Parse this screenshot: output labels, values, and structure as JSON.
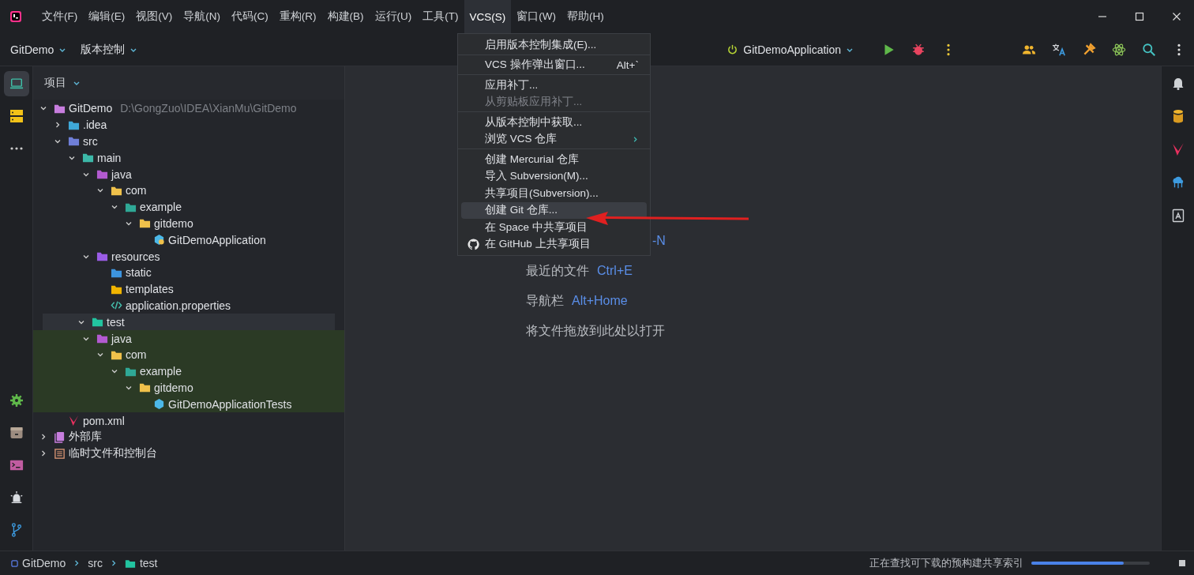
{
  "menu_bar": [
    {
      "label": "文件(F)",
      "selected": false
    },
    {
      "label": "编辑(E)",
      "selected": false
    },
    {
      "label": "视图(V)",
      "selected": false
    },
    {
      "label": "导航(N)",
      "selected": false
    },
    {
      "label": "代码(C)",
      "selected": false
    },
    {
      "label": "重构(R)",
      "selected": false
    },
    {
      "label": "构建(B)",
      "selected": false
    },
    {
      "label": "运行(U)",
      "selected": false
    },
    {
      "label": "工具(T)",
      "selected": false
    },
    {
      "label": "VCS(S)",
      "selected": true
    },
    {
      "label": "窗口(W)",
      "selected": false
    },
    {
      "label": "帮助(H)",
      "selected": false
    }
  ],
  "toolbar": {
    "project": "GitDemo",
    "vcs": "版本控制",
    "run_config": "GitDemoApplication"
  },
  "left_stripe": {
    "top": [
      {
        "selected": true
      },
      {
        "selected": false
      },
      {
        "selected": false
      }
    ],
    "bottom": [
      {
        "selected": false
      },
      {
        "selected": false
      },
      {
        "selected": false
      },
      {
        "selected": false
      },
      {
        "selected": false
      }
    ]
  },
  "project_panel": {
    "title": "项目"
  },
  "project_tree": [
    {
      "label": "GitDemo",
      "path": "D:\\GongZuo\\IDEA\\XianMu\\GitDemo",
      "kind": "module",
      "expanded": true,
      "selected": false,
      "highlighted": false,
      "children": [
        {
          "label": ".idea",
          "kind": "config",
          "expanded": false,
          "selected": false,
          "highlighted": false
        },
        {
          "label": "src",
          "kind": "src",
          "expanded": true,
          "selected": false,
          "highlighted": false,
          "children": [
            {
              "label": "main",
              "kind": "teal-folder",
              "expanded": true,
              "selected": false,
              "highlighted": false,
              "children": [
                {
                  "label": "java",
                  "kind": "java-root",
                  "expanded": true,
                  "selected": false,
                  "highlighted": false,
                  "children": [
                    {
                      "label": "com",
                      "kind": "package",
                      "expanded": true,
                      "selected": false,
                      "highlighted": false,
                      "children": [
                        {
                          "label": "example",
                          "kind": "teal-package",
                          "expanded": true,
                          "selected": false,
                          "highlighted": false,
                          "children": [
                            {
                              "label": "gitdemo",
                              "kind": "package",
                              "expanded": true,
                              "selected": false,
                              "highlighted": false,
                              "children": [
                                {
                                  "label": "GitDemoApplication",
                                  "kind": "app-class",
                                  "selected": false,
                                  "highlighted": false
                                }
                              ]
                            }
                          ]
                        }
                      ]
                    }
                  ]
                },
                {
                  "label": "resources",
                  "kind": "resources",
                  "expanded": true,
                  "selected": false,
                  "highlighted": false,
                  "children": [
                    {
                      "label": "static",
                      "kind": "web-folder",
                      "selected": false,
                      "highlighted": false
                    },
                    {
                      "label": "templates",
                      "kind": "template-folder",
                      "selected": false,
                      "highlighted": false
                    },
                    {
                      "label": "application.properties",
                      "kind": "properties",
                      "selected": false,
                      "highlighted": false
                    }
                  ]
                }
              ]
            },
            {
              "label": "test",
              "kind": "test-root",
              "expanded": true,
              "selected": true,
              "highlighted": false,
              "children": [
                {
                  "label": "java",
                  "kind": "java-root",
                  "expanded": true,
                  "selected": false,
                  "highlighted": true,
                  "children": [
                    {
                      "label": "com",
                      "kind": "package",
                      "expanded": true,
                      "selected": false,
                      "highlighted": true,
                      "children": [
                        {
                          "label": "example",
                          "kind": "teal-package",
                          "expanded": true,
                          "selected": false,
                          "highlighted": true,
                          "children": [
                            {
                              "label": "gitdemo",
                              "kind": "package",
                              "expanded": true,
                              "selected": false,
                              "highlighted": true,
                              "children": [
                                {
                                  "label": "GitDemoApplicationTests",
                                  "kind": "test-class",
                                  "selected": false,
                                  "highlighted": true
                                }
                              ]
                            }
                          ]
                        }
                      ]
                    }
                  ]
                }
              ]
            }
          ]
        },
        {
          "label": "pom.xml",
          "kind": "maven",
          "selected": false,
          "highlighted": false
        }
      ]
    },
    {
      "label": "外部库",
      "kind": "library",
      "expanded": false,
      "selected": false,
      "highlighted": false
    },
    {
      "label": "临时文件和控制台",
      "kind": "scratch",
      "expanded": false,
      "selected": false,
      "highlighted": false
    }
  ],
  "editor_hints": [
    {
      "shortcut": "-N"
    },
    {
      "label": "最近的文件",
      "shortcut": "Ctrl+E"
    },
    {
      "label": "导航栏",
      "shortcut": "Alt+Home"
    }
  ],
  "editor_drop_hint": "将文件拖放到此处以打开",
  "vcs_menu": [
    [
      {
        "label": "启用版本控制集成(E)...",
        "disabled": false,
        "selected": false
      }
    ],
    [
      {
        "label": "VCS 操作弹出窗口...",
        "shortcut": "Alt+`",
        "disabled": false,
        "selected": false
      }
    ],
    [
      {
        "label": "应用补丁...",
        "disabled": false,
        "selected": false
      },
      {
        "label": "从剪贴板应用补丁...",
        "disabled": true,
        "selected": false
      }
    ],
    [
      {
        "label": "从版本控制中获取...",
        "disabled": false,
        "selected": false
      },
      {
        "label": "浏览 VCS 仓库",
        "submenu": true,
        "disabled": false,
        "selected": false
      }
    ],
    [
      {
        "label": "创建 Mercurial 仓库",
        "disabled": false,
        "selected": false
      },
      {
        "label": "导入 Subversion(M)...",
        "disabled": false,
        "selected": false
      },
      {
        "label": "共享项目(Subversion)...",
        "disabled": false,
        "selected": false
      },
      {
        "label": "创建 Git 仓库...",
        "disabled": false,
        "selected": true
      },
      {
        "label": "在 Space 中共享项目",
        "disabled": false,
        "selected": false
      },
      {
        "label": "在 GitHub 上共享项目",
        "kind": "github",
        "disabled": false,
        "selected": false
      }
    ]
  ],
  "status_bar": {
    "breadcrumbs": [
      {
        "label": "GitDemo",
        "kind": "module"
      },
      {
        "label": "src",
        "kind": "folder"
      },
      {
        "label": "test",
        "kind": "test-root"
      }
    ],
    "message": "正在查找可下载的预构建共享索引",
    "level": 0.78
  }
}
